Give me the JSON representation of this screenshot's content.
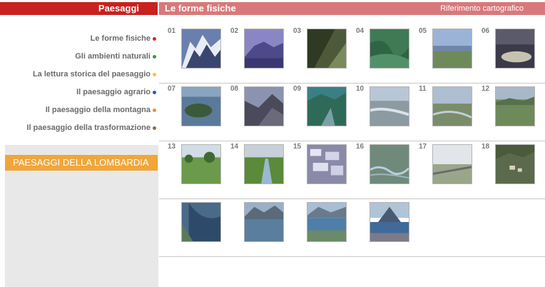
{
  "header": {
    "left_title": "Paesaggi",
    "right_title": "Le forme fisiche",
    "right_link": "Riferimento cartografico"
  },
  "nav": [
    {
      "label": "Le forme fisiche",
      "dot_color": "#cc2a24"
    },
    {
      "label": "Gli ambienti naturali",
      "dot_color": "#3a9a3a"
    },
    {
      "label": "La lettura storica del paesaggio",
      "dot_color": "#f2c531"
    },
    {
      "label": "Il paesaggio agrario",
      "dot_color": "#2a55c8"
    },
    {
      "label": "Il paesaggio della montagna",
      "dot_color": "#f08a3c"
    },
    {
      "label": "Il paesaggio della trasformazione",
      "dot_color": "#9a6a3a"
    }
  ],
  "lombardia": {
    "label": "PAESAGGI DELLA LOMBARDIA"
  },
  "photos": [
    {
      "number": "01",
      "icon": "snowy-mountain-photo"
    },
    {
      "number": "02",
      "icon": "blue-mountain-photo"
    },
    {
      "number": "03",
      "icon": "green-slope-photo"
    },
    {
      "number": "04",
      "icon": "green-valley-photo"
    },
    {
      "number": "05",
      "icon": "plain-lake-photo"
    },
    {
      "number": "06",
      "icon": "sunset-lake-photo"
    },
    {
      "number": "07",
      "icon": "lake-island-photo"
    },
    {
      "number": "08",
      "icon": "dark-lake-photo"
    },
    {
      "number": "09",
      "icon": "teal-valley-photo"
    },
    {
      "number": "10",
      "icon": "riverbed-photo"
    },
    {
      "number": "11",
      "icon": "river-plain-photo"
    },
    {
      "number": "12",
      "icon": "hills-plain-photo"
    },
    {
      "number": "13",
      "icon": "meadow-trees-photo"
    },
    {
      "number": "14",
      "icon": "canal-photo"
    },
    {
      "number": "15",
      "icon": "flooded-fields-photo"
    },
    {
      "number": "16",
      "icon": "delta-photo"
    },
    {
      "number": "17",
      "icon": "road-field-photo"
    },
    {
      "number": "18",
      "icon": "hillside-village-photo"
    },
    {
      "number": "",
      "icon": "lake-aerial-photo"
    },
    {
      "number": "",
      "icon": "lake-mountains-photo"
    },
    {
      "number": "",
      "icon": "lake-shore-photo"
    },
    {
      "number": "",
      "icon": "harbor-mountain-photo"
    }
  ]
}
